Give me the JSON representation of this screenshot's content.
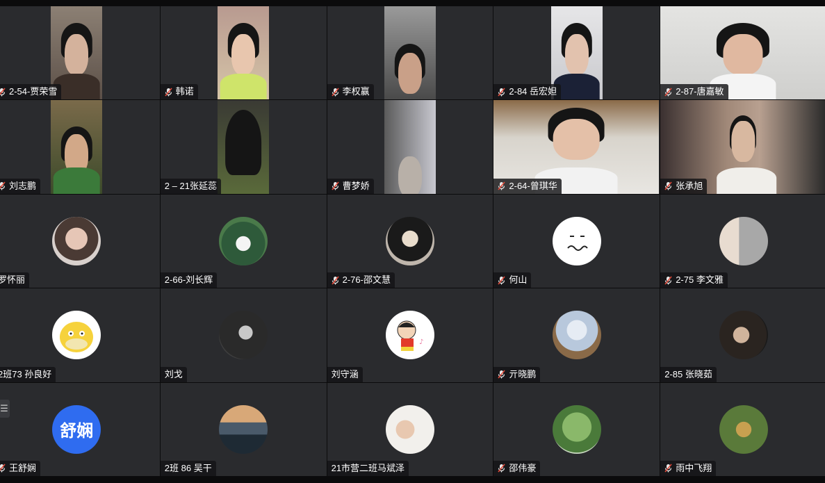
{
  "participants": [
    {
      "name": "2-54-贾荣雪",
      "muted": true
    },
    {
      "name": "韩诺",
      "muted": true
    },
    {
      "name": "李权赢",
      "muted": true
    },
    {
      "name": "2-84 岳宏妲",
      "muted": true
    },
    {
      "name": "2-87-唐嘉敏",
      "muted": true
    },
    {
      "name": "刘志鹏",
      "muted": true
    },
    {
      "name": "2 – 21张延蕊",
      "muted": false
    },
    {
      "name": "曹梦娇",
      "muted": true
    },
    {
      "name": "2-64-曾琪华",
      "muted": true
    },
    {
      "name": "张承旭",
      "muted": true
    },
    {
      "name": "罗怀丽",
      "muted": false
    },
    {
      "name": "2-66-刘长辉",
      "muted": false
    },
    {
      "name": "2-76-邵文慧",
      "muted": true
    },
    {
      "name": "何山",
      "muted": true
    },
    {
      "name": "2-75 李文雅",
      "muted": true
    },
    {
      "name": "2班73 孙良好",
      "muted": false
    },
    {
      "name": "刘戈",
      "muted": false
    },
    {
      "name": "刘守涵",
      "muted": false
    },
    {
      "name": "亓晓鹏",
      "muted": true
    },
    {
      "name": "2-85 张晓茹",
      "muted": false
    },
    {
      "name": "王舒娴",
      "muted": true,
      "avatar_text": "舒娴"
    },
    {
      "name": "2班 86 吴干",
      "muted": false
    },
    {
      "name": "21市营二班马斌泽",
      "muted": false
    },
    {
      "name": "邵伟豪",
      "muted": true
    },
    {
      "name": "雨中飞翔",
      "muted": true
    }
  ],
  "colors": {
    "tile_bg": "#2a2b2e",
    "label_bg": "#141416",
    "avatar_blue": "#2f6cf0",
    "mic_muted": "#e0e0e0"
  },
  "menu_icon": "list-icon"
}
